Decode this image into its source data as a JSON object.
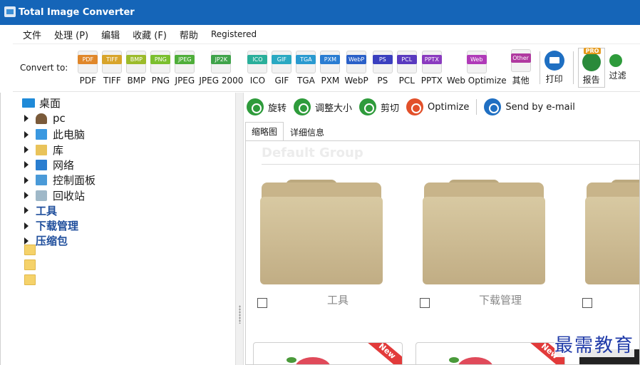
{
  "window": {
    "title": "Total Image Converter"
  },
  "menu": {
    "items": [
      "文件",
      "处理 (P)",
      "编辑",
      "收藏 (F)",
      "帮助",
      "Registered"
    ]
  },
  "toolbar": {
    "convert_label": "Convert to:",
    "formats": [
      {
        "label": "PDF",
        "tag": "PDF",
        "color": "#e0872a"
      },
      {
        "label": "TIFF",
        "tag": "TIFF",
        "color": "#d8a42a"
      },
      {
        "label": "BMP",
        "tag": "BMP",
        "color": "#9cbb2a"
      },
      {
        "label": "PNG",
        "tag": "PNG",
        "color": "#7bbf2e"
      },
      {
        "label": "JPEG",
        "tag": "JPEG",
        "color": "#4fae3a"
      },
      {
        "label": "JPEG 2000",
        "tag": "JP2K",
        "color": "#3fa34a"
      },
      {
        "label": "ICO",
        "tag": "ICO",
        "color": "#2aaf9a"
      },
      {
        "label": "GIF",
        "tag": "GIF",
        "color": "#2aa9c2"
      },
      {
        "label": "TGA",
        "tag": "TGA",
        "color": "#2a9ad0"
      },
      {
        "label": "PXM",
        "tag": "PXM",
        "color": "#2a7dd2"
      },
      {
        "label": "WebP",
        "tag": "WebP",
        "color": "#2a60c8"
      },
      {
        "label": "PS",
        "tag": "PS",
        "color": "#3a3fbf"
      },
      {
        "label": "PCL",
        "tag": "PCL",
        "color": "#5a3abf"
      },
      {
        "label": "PPTX",
        "tag": "PPTX",
        "color": "#8a3abf"
      },
      {
        "label": "Web Optimize",
        "tag": "Web",
        "color": "#b03ab8"
      },
      {
        "label": "其他",
        "tag": "Other",
        "color": "#b03aa0"
      }
    ],
    "print_label": "打印",
    "report_label": "报告",
    "pro_badge": "PRO",
    "filter_label": "过滤"
  },
  "tree": {
    "root": "桌面",
    "nodes": [
      {
        "label": "pc",
        "icon": "person-icon",
        "bold": false
      },
      {
        "label": "此电脑",
        "icon": "computer-icon",
        "bold": false
      },
      {
        "label": "库",
        "icon": "library-icon",
        "bold": false
      },
      {
        "label": "网络",
        "icon": "network-icon",
        "bold": false
      },
      {
        "label": "控制面板",
        "icon": "control-panel-icon",
        "bold": false
      },
      {
        "label": "回收站",
        "icon": "recycle-bin-icon",
        "bold": false
      },
      {
        "label": "工具",
        "icon": "folder-icon",
        "bold": true
      },
      {
        "label": "下载管理",
        "icon": "folder-icon",
        "bold": true
      },
      {
        "label": "压缩包",
        "icon": "folder-icon",
        "bold": true
      }
    ]
  },
  "actions": {
    "rotate": "旋转",
    "resize": "调整大小",
    "crop": "剪切",
    "optimize": "Optimize",
    "email": "Send by e-mail"
  },
  "tabs": [
    "缩略图",
    "详细信息"
  ],
  "thumbnails": {
    "group_title": "Default Group",
    "folders": [
      "工具",
      "下载管理",
      ""
    ],
    "new_badge": "New"
  },
  "watermark": "最需教育"
}
